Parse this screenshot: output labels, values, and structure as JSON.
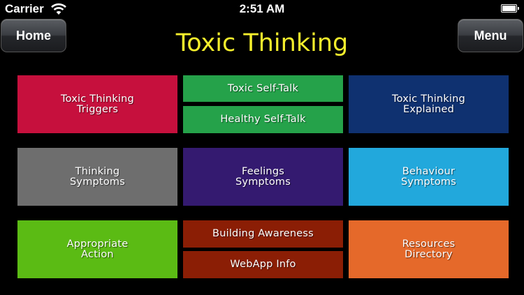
{
  "status_bar": {
    "carrier": "Carrier",
    "time": "2:51 AM"
  },
  "header": {
    "home_label": "Home",
    "title": "Toxic Thinking",
    "menu_label": "Menu",
    "title_color": "#f4ee2c"
  },
  "tiles": [
    {
      "label": "Toxic Thinking\nTriggers",
      "color": "#c6103d"
    },
    {
      "label": "Toxic Self-Talk",
      "color": "#25a24a"
    },
    {
      "label": "Healthy Self-Talk",
      "color": "#25a24a"
    },
    {
      "label": "Toxic Thinking\nExplained",
      "color": "#0f3170"
    },
    {
      "label": "Thinking\nSymptoms",
      "color": "#6e6e6e"
    },
    {
      "label": "Feelings\nSymptoms",
      "color": "#341a70"
    },
    {
      "label": "Behaviour\nSymptoms",
      "color": "#22a8dc"
    },
    {
      "label": "Appropriate\nAction",
      "color": "#5bbb14"
    },
    {
      "label": "Building Awareness",
      "color": "#8b1e05"
    },
    {
      "label": "WebApp Info",
      "color": "#8b1e05"
    },
    {
      "label": "Resources\nDirectory",
      "color": "#e5692a"
    }
  ]
}
